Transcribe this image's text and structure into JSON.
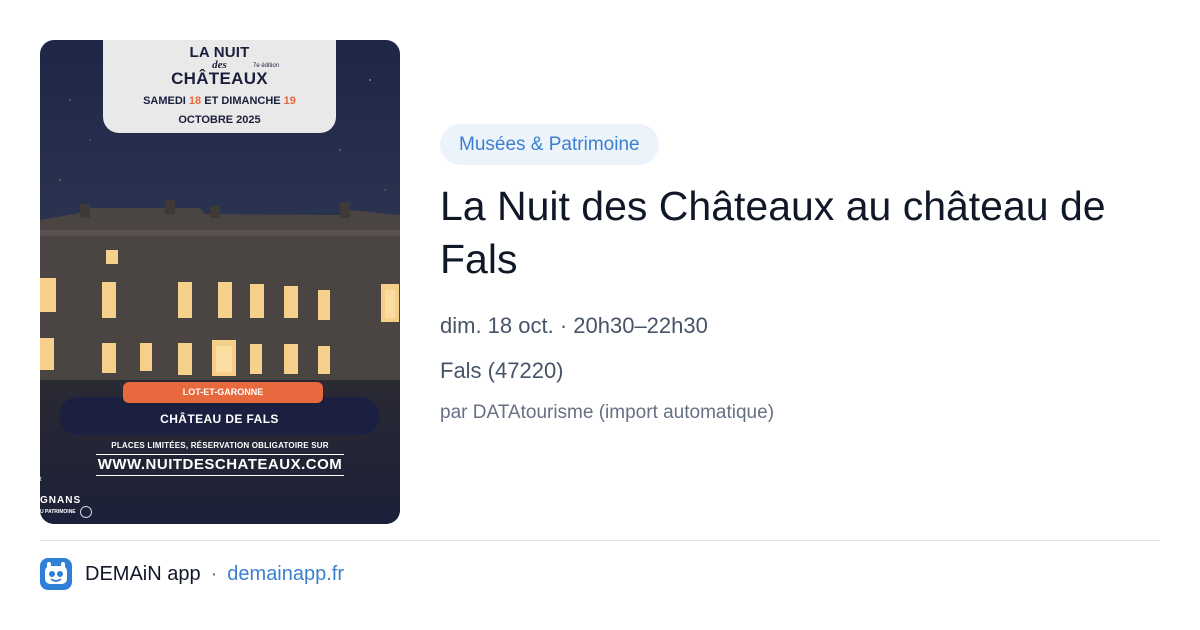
{
  "poster": {
    "title_line1": "LA NUIT",
    "title_line2": "des",
    "title_line3": "CHÂTEAUX",
    "edition": "7e édition",
    "date_pre": "SAMEDI ",
    "date_day1": "18",
    "date_mid": " ET DIMANCHE ",
    "date_day2": "19",
    "date_month": "OCTOBRE 2025",
    "department": "LOT-ET-GARONNE",
    "place": "CHÂTEAU DE FALS",
    "note": "PLACES LIMITÉES, RÉSERVATION OBLIGATOIRE SUR",
    "url": "WWW.NUITDESCHATEAUX.COM",
    "sponsor_at": "t",
    "sponsor": "GNANS",
    "sponsor_sub": "U PATRIMOINE",
    "accent_color": "#e8693d"
  },
  "event": {
    "category": "Musées & Patrimoine",
    "title": "La Nuit des Châteaux au château de Fals",
    "datetime": "dim. 18 oct. · 20h30–22h30",
    "location": "Fals (47220)",
    "source": "par DATAtourisme (import automatique)"
  },
  "footer": {
    "app_icon": "demain-app-icon",
    "app_name": "DEMAiN app",
    "separator": "·",
    "app_url": "demainapp.fr",
    "link_color": "#3b7fcf"
  }
}
